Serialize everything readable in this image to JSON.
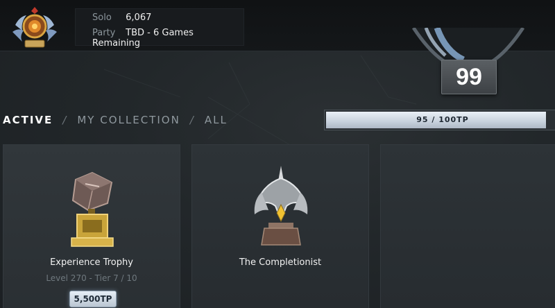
{
  "header": {
    "rank_medal_icon": "rank-medal-icon",
    "stats": [
      {
        "label": "Solo",
        "value": "6,067"
      },
      {
        "label": "Party",
        "value": "TBD - 6 Games Remaining"
      }
    ]
  },
  "level": {
    "value": "99",
    "emblem_icon": "battle-level-emblem-icon"
  },
  "tabs": {
    "active": "ACTIVE",
    "collection": "MY COLLECTION",
    "all": "ALL",
    "separator": "/"
  },
  "progress": {
    "current": 95,
    "max": 100,
    "text": "95 / 100TP"
  },
  "cards": [
    {
      "title": "Experience Trophy",
      "subtitle": "Level 270 - Tier 7 / 10",
      "price": "5,500TP",
      "icon": "experience-trophy-icon"
    },
    {
      "title": "The Completionist",
      "icon": "completionist-trophy-icon"
    }
  ],
  "colors": {
    "background": "#22272a",
    "topbar": "#121416",
    "accent_bar": "#dfe7ef",
    "text_muted": "#8c969c"
  }
}
